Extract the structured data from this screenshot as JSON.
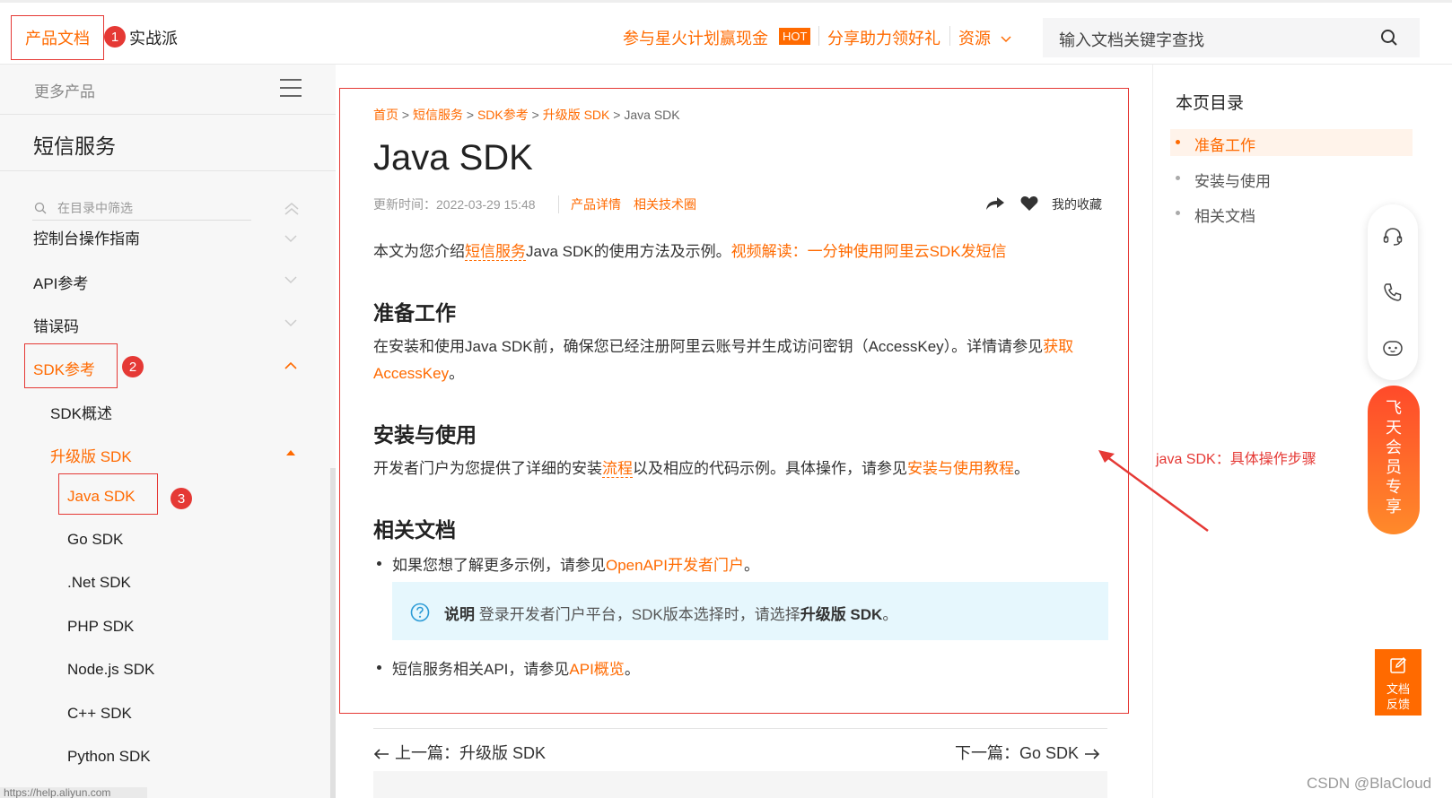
{
  "header": {
    "tab_docs": "产品文档",
    "tab_practice": "实战派",
    "link_spark": "参与星火计划赢现金",
    "hot_badge": "HOT",
    "link_share": "分享助力领好礼",
    "link_resources": "资源",
    "search_placeholder": "输入文档关键字查找"
  },
  "annotations": {
    "badge_1": "1",
    "badge_2": "2",
    "badge_3": "3",
    "arrow_note": "java SDK：具体操作步骤",
    "watermark": "CSDN @BlaCloud"
  },
  "sidebar": {
    "more_products": "更多产品",
    "service_title": "短信服务",
    "filter_placeholder": "在目录中筛选",
    "items": [
      {
        "label": "控制台操作指南"
      },
      {
        "label": "API参考"
      },
      {
        "label": "错误码"
      },
      {
        "label": "SDK参考"
      },
      {
        "label": "SDK概述"
      },
      {
        "label": "升级版 SDK"
      },
      {
        "label": "Java SDK"
      },
      {
        "label": "Go SDK"
      },
      {
        "label": ".Net SDK"
      },
      {
        "label": "PHP SDK"
      },
      {
        "label": "Node.js SDK"
      },
      {
        "label": "C++ SDK"
      },
      {
        "label": "Python SDK"
      }
    ],
    "status_url": "https://help.aliyun.com"
  },
  "main": {
    "breadcrumb": [
      "首页",
      "短信服务",
      "SDK参考",
      "升级版 SDK",
      "Java SDK"
    ],
    "title": "Java SDK",
    "updated": "更新时间：2022-03-29 15:48",
    "link_details": "产品详情",
    "link_circle": "相关技术圈",
    "favorites": "我的收藏",
    "intro_a": "本文为您介绍",
    "intro_link": "短信服务",
    "intro_b": "Java SDK的使用方法及示例。",
    "intro_video": "视频解读：一分钟使用阿里云SDK发短信",
    "h_prepare": "准备工作",
    "prepare_a": "在安装和使用Java SDK前，确保您已经注册阿里云账号并生成访问密钥（AccessKey）。详情请参见",
    "prepare_link1": "获取",
    "prepare_link2": "AccessKey",
    "prepare_end": "。",
    "h_install": "安装与使用",
    "install_a": "开发者门户为您提供了详细的安装",
    "install_link1": "流程",
    "install_b": "以及相应的代码示例。具体操作，请参见",
    "install_link2": "安装与使用教程",
    "install_end": "。",
    "h_related": "相关文档",
    "bullet1_a": "如果您想了解更多示例，请参见",
    "bullet1_link": "OpenAPI开发者门户",
    "bullet1_end": "。",
    "note_label": "说明",
    "note_a": "登录开发者门户平台，SDK版本选择时，请选择",
    "note_bold": "升级版 SDK",
    "note_end": "。",
    "bullet2_a": "短信服务相关API，请参见",
    "bullet2_link": "API概览",
    "bullet2_end": "。",
    "prev": "上一篇：升级版 SDK",
    "next": "下一篇：Go SDK"
  },
  "toc": {
    "title": "本页目录",
    "items": [
      "准备工作",
      "安装与使用",
      "相关文档"
    ]
  },
  "floating": {
    "vip_chars": [
      "飞",
      "天",
      "会",
      "员",
      "专",
      "享"
    ],
    "feedback_1": "文档",
    "feedback_2": "反馈"
  },
  "colors": {
    "accent": "#ff6a00",
    "annotation_red": "#e53935",
    "note_bg": "#e6f7fd"
  }
}
